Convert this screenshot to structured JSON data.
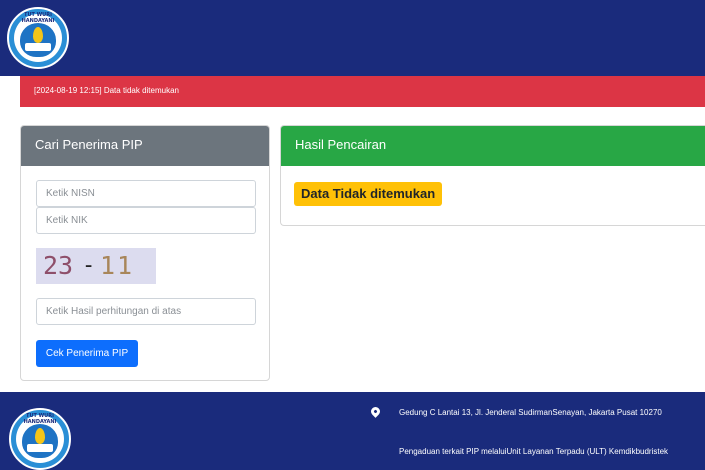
{
  "header": {
    "logo_text": "TUT WURI HANDAYANI",
    "background": "#1a2b7c"
  },
  "alert": {
    "message": "[2024-08-19 12:15] Data tidak ditemukan",
    "color": "#dc3545"
  },
  "search_card": {
    "title": "Cari Penerima PIP",
    "nisn_placeholder": "Ketik NISN",
    "nik_placeholder": "Ketik NIK",
    "captcha": {
      "left": "23",
      "operator": "-",
      "right": "11"
    },
    "answer_placeholder": "Ketik Hasil perhitungan di atas",
    "submit_label": "Cek Penerima PIP"
  },
  "result_card": {
    "title": "Hasil Pencairan",
    "status": "Data Tidak ditemukan",
    "status_color": "#ffc107"
  },
  "footer": {
    "address": "Gedung C Lantai 13, Jl. Jenderal SudirmanSenayan, Jakarta Pusat 10270",
    "complaint": "Pengaduan terkait PIP melaluiUnit Layanan Terpadu (ULT) Kemdikbudristek",
    "location_icon": "map-pin-icon"
  }
}
